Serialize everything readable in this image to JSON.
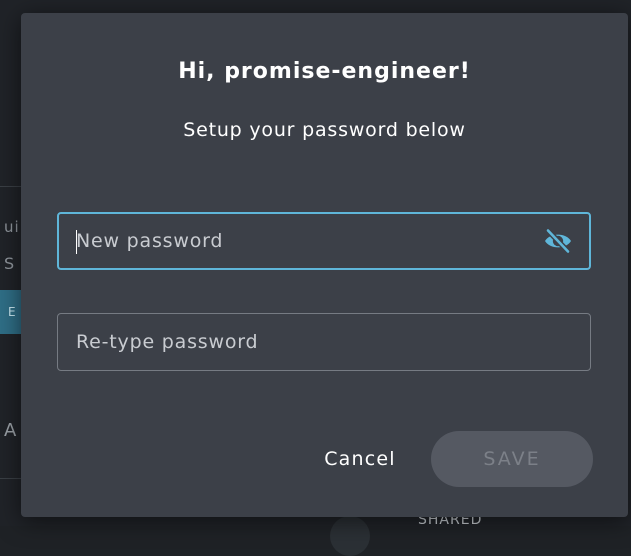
{
  "background": {
    "fragment_1": "ui",
    "fragment_2": "S",
    "fragment_3": "A",
    "selected_fragment": "E",
    "shared_label": "SHARED"
  },
  "dialog": {
    "title": "Hi, promise-engineer!",
    "subtitle": "Setup your password below",
    "new_password": {
      "placeholder": "New password",
      "value": "",
      "visibility_icon": "eye-slash-icon"
    },
    "retype_password": {
      "placeholder": "Re-type password",
      "value": ""
    },
    "cancel_label": "Cancel",
    "save_label": "SAVE"
  },
  "colors": {
    "dialog_bg": "#3c4048",
    "focus_border": "#5fb6d9",
    "icon": "#5fb6d9",
    "save_disabled_bg": "#555962",
    "save_disabled_text": "#7c8088"
  }
}
